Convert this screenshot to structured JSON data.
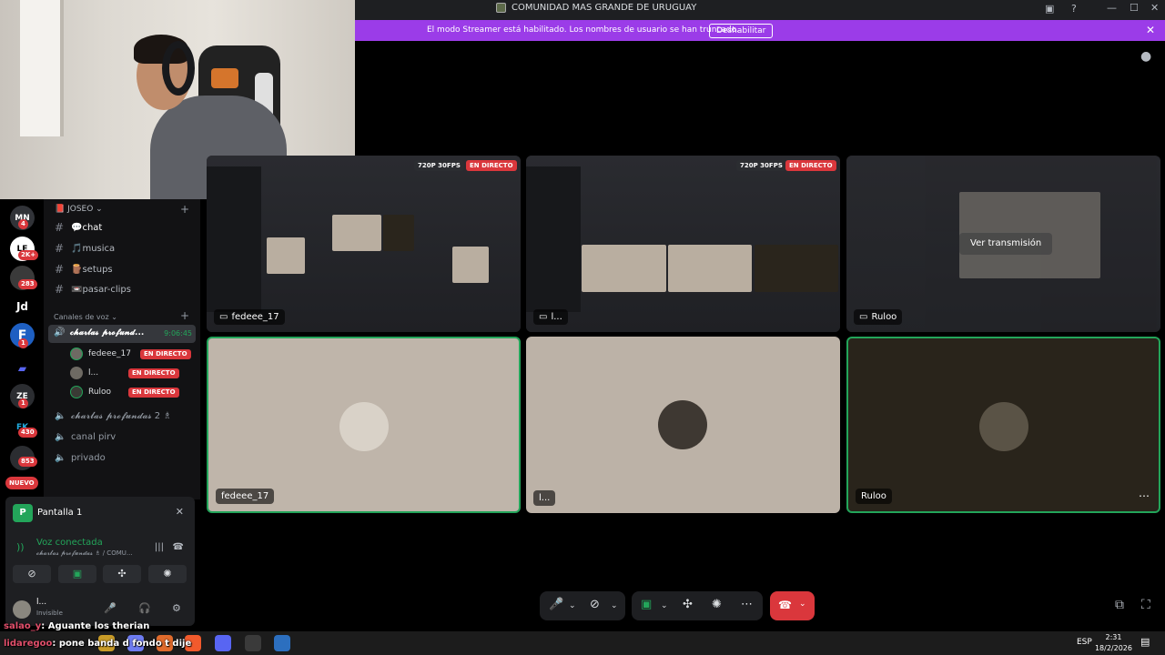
{
  "window": {
    "title": "COMUNIDAD MAS GRANDE DE URUGUAY",
    "minimize": "—",
    "maximize": "☐",
    "close": "✕"
  },
  "banner": {
    "message": "El modo Streamer está habilitado. Los nombres de usuario se han truncado.",
    "button": "Deshabilitar",
    "close": "✕"
  },
  "rail": {
    "servers": [
      {
        "label": "MN",
        "badge": "4"
      },
      {
        "label": "LE",
        "badge": "2K+"
      },
      {
        "label": "",
        "badge": "283"
      },
      {
        "label": "Jd",
        "badge": ""
      },
      {
        "label": "F",
        "badge": "1"
      },
      {
        "label": "",
        "badge": ""
      },
      {
        "label": "ZE",
        "badge": "1"
      },
      {
        "label": "FK",
        "badge": "430"
      },
      {
        "label": "",
        "badge": "853"
      }
    ],
    "new_label": "NUEVO"
  },
  "sidebar": {
    "server_name": "JOSEO",
    "text_channels": [
      {
        "name": "💬chat"
      },
      {
        "name": "🎵musica"
      },
      {
        "name": "🪵setups"
      },
      {
        "name": "📼pasar-clips"
      }
    ],
    "voice_header": "Canales de voz",
    "active_voice": {
      "name": "𝓬𝓱𝓪𝓻𝓵𝓪𝓼 𝓹𝓻𝓸𝓯𝓾𝓷𝓭...",
      "time": "9:06:45"
    },
    "voice_users": [
      {
        "name": "fedeee_17",
        "live": "EN DIRECTO"
      },
      {
        "name": "l...",
        "live": "EN DIRECTO"
      },
      {
        "name": "Ruloo",
        "live": "EN DIRECTO"
      }
    ],
    "voice_channels": [
      {
        "name": "𝓬𝓱𝓪𝓻𝓵𝓪𝓼 𝓹𝓻𝓸𝓯𝓾𝓷𝓭𝓪𝓼 2 ♗"
      },
      {
        "name": "canal pirv"
      },
      {
        "name": "privado"
      }
    ]
  },
  "panel": {
    "screen_name": "Pantalla 1",
    "status": "Voz conectada",
    "status_sub": "𝓬𝓱𝓪𝓻𝓵𝓪𝓼 𝓹𝓻𝓸𝓯𝓾𝓷𝓭𝓪𝓼 ♗ / COMU...",
    "user_name": "l...",
    "user_status": "Invisible"
  },
  "chat_overlay": [
    {
      "user": "salao_y",
      "text": ": Aguante los therian"
    },
    {
      "user": "lidaregoo",
      "text": ": pone banda d fondo t dije"
    }
  ],
  "stage": {
    "streams": [
      {
        "name": "fedeee_17",
        "quality": "720P 30FPS",
        "live": "EN DIRECTO"
      },
      {
        "name": "l...",
        "quality": "720P 30FPS",
        "live": "EN DIRECTO"
      },
      {
        "name": "Ruloo",
        "button": "Ver transmisión"
      }
    ],
    "tiles": [
      {
        "name": "fedeee_17"
      },
      {
        "name": "l..."
      },
      {
        "name": "Ruloo"
      }
    ]
  },
  "taskbar": {
    "lang": "ESP",
    "time": "2:31",
    "date": "18/2/2026"
  },
  "colors": {
    "accent": "#9b3ce8",
    "live": "#da373c",
    "connected": "#23a55a"
  }
}
